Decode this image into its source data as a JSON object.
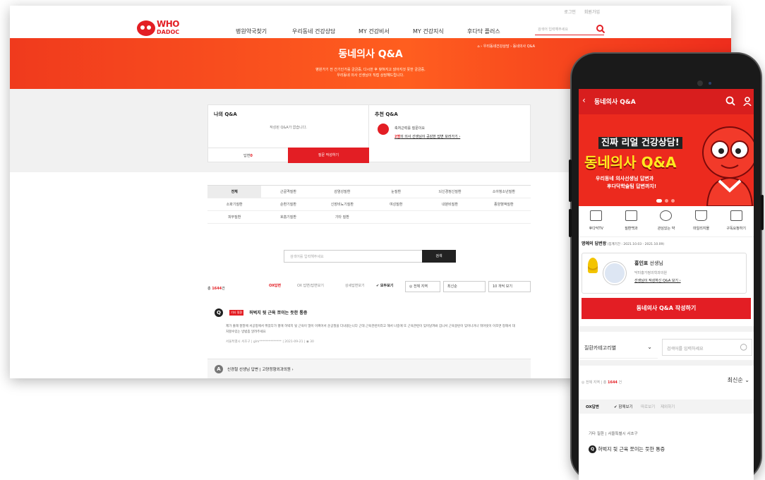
{
  "desktop": {
    "util": [
      "로그인",
      "회원가입"
    ],
    "logo": {
      "top": "WHO",
      "bottom": "DADOC"
    },
    "menu": [
      "병원약국찾기",
      "우리동네 건강상담",
      "MY 건강비서",
      "MY 건강지식",
      "후다닥 플러스"
    ],
    "search_placeholder": "검색어 입력해주세요",
    "hero": {
      "title": "동네의사 Q&A",
      "breadcrumb": "⌂ › 우리동네건강상담 › 동네의사 Q&A",
      "sub1": "병원가기 전 간기인가를 궁금증, 다시한 후 찾혀지고 않아지것 못한 궁금증,",
      "sub2": "우리동네 의사 선생님이 직접 상담해드립니다."
    },
    "my_qa": {
      "title": "나의 Q&A",
      "empty": "작성된 Q&A가 없습니다.",
      "answers_label": "답변",
      "answers_count": "0",
      "write": "질문 작성하기"
    },
    "rec_qa": {
      "title": "추천 Q&A",
      "line1": "축처근력를 질문이요",
      "line2_count": "2명",
      "line2_rest": "의 의사 선생님이 공감한 답변 보러가기 ›"
    },
    "categories": [
      "전체",
      "근골격질환",
      "감염성질환",
      "눈질환",
      "뇌신경정신질환",
      "소아청소년질환",
      "소화기질환",
      "순환기질환",
      "신장비뇨기질환",
      "여성질환",
      "내분비질환",
      "종양혈액질환",
      "피부질환",
      "호흡기질환",
      "기타 질환"
    ],
    "search2": {
      "placeholder": "검색어를 입력해주세요",
      "button": "검색"
    },
    "total": {
      "prefix": "총 ",
      "count": "1644",
      "suffix": "건"
    },
    "filters": {
      "ox": "OX답변",
      "ox_view": "OX 답변/답변보기",
      "detail_view": "상세답변보기",
      "all_view": "✔ 모두보기",
      "region": "◎ 전체 지역",
      "sort": "최신순",
      "per_page": "10 개씩 보기"
    },
    "question": {
      "badge": "Q",
      "tag": "기타 질환",
      "title": "허벅지 뒷 근육 쪼이는 듯한 통증",
      "body": "제가 출해 잘말에 서공정에서 뛰었다가 평에 허벅지 뒷 근육이 많이 아찌어서 운공질을 다녀왔는니다 근대 근육관련이라고 해서 나중에 또 근육관련이 잊어날까봐 겁니서 근육걸린이 잊어나거나 뭐어릿이 이조면 정해서 대처할수있는 방법좀 알려주세요",
      "meta": "서울특별시 서초구 | glm************** | 2021-09-21 | ◉ 30"
    },
    "answer": {
      "badge": "A",
      "text": "신경철 선생님 답변 | 고양정형외과의원 ›"
    }
  },
  "mobile": {
    "title": "동네의사 Q&A",
    "banner": {
      "l1": "진짜 리얼 건강상담!",
      "l2": "동네의사 Q&A",
      "l3": "우리동네 의사선생님 답변과",
      "l4": "후다닥학술팀 답변까지!"
    },
    "icons": [
      {
        "icon": "tv-icon",
        "label": "후다닥TV"
      },
      {
        "icon": "book-icon",
        "label": "질환백과"
      },
      {
        "icon": "pill-icon",
        "label": "관심있는 약"
      },
      {
        "icon": "basket-icon",
        "label": "마일리지몰"
      },
      {
        "icon": "request-icon",
        "label": "구독요청하기"
      }
    ],
    "honor": {
      "title": "명예의 답변왕",
      "period": " (집계기간 : 2021.10.03 - 2021.10.09)"
    },
    "doctor": {
      "name": "홍인표",
      "suffix": " 선생님",
      "hospital": "닥터홍가정의학과의원",
      "link": "선생님이 작성하신 Q&A 보기 ›"
    },
    "cta": "동네의사 Q&A 작성하기",
    "category_select": "질환카테고리별",
    "search_placeholder": "검색어를 입력하세요",
    "location": {
      "prefix": "◎ 전체 지역 | 총 ",
      "count": "1644",
      "suffix": " 건"
    },
    "sort": "최신순  ⌄",
    "ox": {
      "o1": "OX답변",
      "o2": "✔ 함께보기",
      "o3": "따로보기",
      "o4": "제외하기"
    },
    "q_category": "기타 질환 | 서울특별시 서초구",
    "q_badge": "Q",
    "q_title": "허벅지 뒷 근육 쪼이는 듯한 통증"
  },
  "colors": {
    "accent": "#e31e24",
    "hero_start": "#f03a1d",
    "hero_mid": "#ff5e1f"
  }
}
